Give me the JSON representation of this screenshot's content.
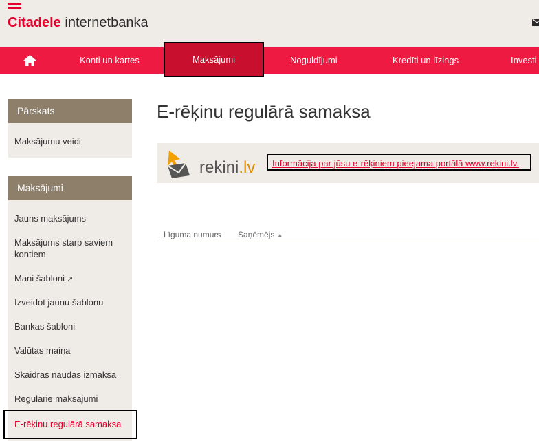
{
  "header": {
    "brand": "Citadele",
    "product": "internetbanka",
    "icons": {
      "logo": "citadele-logo-icon",
      "mail": "mail-icon"
    }
  },
  "nav": {
    "home_icon": "home-icon",
    "items": [
      {
        "label": "Konti un kartes"
      },
      {
        "label": "Maksājumi",
        "active": true
      },
      {
        "label": "Noguldījumi"
      },
      {
        "label": "Kredīti un līzings"
      },
      {
        "label": "Investi"
      }
    ]
  },
  "sidebar": {
    "sections": [
      {
        "title": "Pārskats",
        "items": [
          {
            "label": "Maksājumu veidi"
          }
        ]
      },
      {
        "title": "Maksājumi",
        "items": [
          {
            "label": "Jauns maksājums"
          },
          {
            "label": "Maksājums starp saviem kontiem"
          },
          {
            "label": "Mani šabloni",
            "icon": "external-link-icon",
            "icon_glyph": "↗"
          },
          {
            "label": "Izveidot jaunu šablonu"
          },
          {
            "label": "Bankas šabloni"
          },
          {
            "label": "Valūtas maiņa"
          },
          {
            "label": "Skaidras naudas izmaksa"
          },
          {
            "label": "Regulārie maksājumi"
          },
          {
            "label": "E-rēķinu regulārā samaksa",
            "active": true
          }
        ]
      }
    ]
  },
  "main": {
    "title": "E-rēķinu regulārā samaksa",
    "banner": {
      "logo_text": "rekini",
      "logo_suffix": ".lv",
      "logo_icon": "envelope-arrow-icon",
      "link_text": "Informācija par jūsu e-rēķiniem pieejama portālā www.rekini.lv."
    },
    "table": {
      "columns": [
        {
          "label": "Līguma numurs"
        },
        {
          "label": "Saņēmējs",
          "sort": "ascending",
          "sort_glyph": "▲"
        }
      ]
    }
  },
  "colors": {
    "brand_red": "#e4002b",
    "nav_red": "#ee1a41",
    "nav_active": "#c8102e",
    "sidebar_head": "#8e7f6b",
    "panel_bg": "#efebe7"
  }
}
